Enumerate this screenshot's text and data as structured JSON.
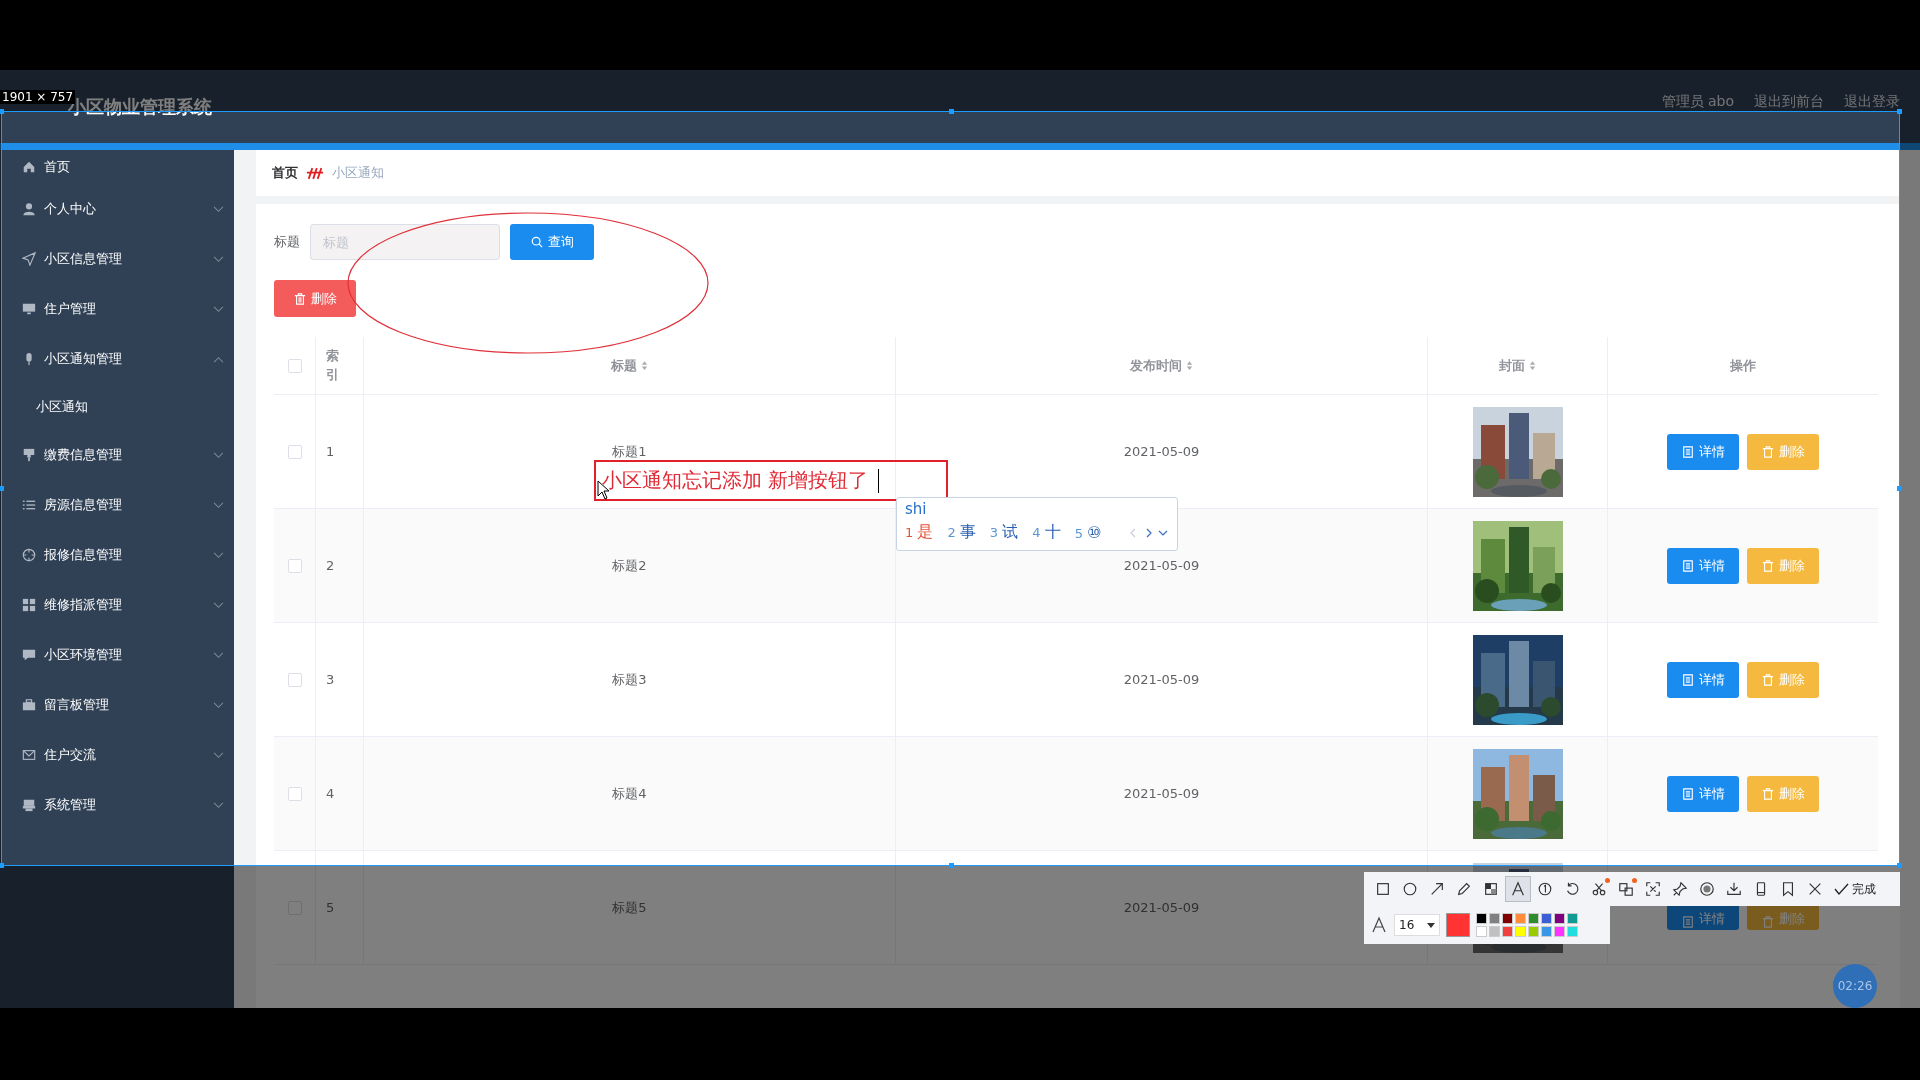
{
  "capture": {
    "size_label": "1901 × 757"
  },
  "header": {
    "title": "小区物业管理系统",
    "links": [
      "管理员 abo",
      "退出到前台",
      "退出登录"
    ]
  },
  "sidebar": {
    "items": [
      {
        "label": "首页",
        "kind": "link"
      },
      {
        "label": "个人中心",
        "kind": "menu",
        "expanded": false
      },
      {
        "label": "小区信息管理",
        "kind": "menu",
        "expanded": false
      },
      {
        "label": "住户管理",
        "kind": "menu",
        "expanded": false
      },
      {
        "label": "小区通知管理",
        "kind": "menu",
        "expanded": true,
        "children": [
          {
            "label": "小区通知"
          }
        ]
      },
      {
        "label": "缴费信息管理",
        "kind": "menu",
        "expanded": false
      },
      {
        "label": "房源信息管理",
        "kind": "menu",
        "expanded": false
      },
      {
        "label": "报修信息管理",
        "kind": "menu",
        "expanded": false
      },
      {
        "label": "维修指派管理",
        "kind": "menu",
        "expanded": false
      },
      {
        "label": "小区环境管理",
        "kind": "menu",
        "expanded": false
      },
      {
        "label": "留言板管理",
        "kind": "menu",
        "expanded": false
      },
      {
        "label": "住户交流",
        "kind": "menu",
        "expanded": false
      },
      {
        "label": "系统管理",
        "kind": "menu",
        "expanded": false
      }
    ]
  },
  "breadcrumb": [
    "首页",
    "小区通知"
  ],
  "search": {
    "label": "标题",
    "placeholder": "标题",
    "button": "查询"
  },
  "delete_button": "删除",
  "table": {
    "all_checked": false,
    "columns": [
      {
        "label": "索引",
        "sortable": false
      },
      {
        "label": "标题",
        "sortable": true
      },
      {
        "label": "发布时间",
        "sortable": true
      },
      {
        "label": "封面",
        "sortable": true
      },
      {
        "label": "操作",
        "sortable": false
      }
    ],
    "rows": [
      {
        "checked": false,
        "index": "1",
        "title": "标题1",
        "published": "2021-05-09",
        "cover": {
          "kind": "picture"
        },
        "actions": [
          "详情",
          "删除"
        ]
      },
      {
        "checked": false,
        "index": "2",
        "title": "标题2",
        "published": "2021-05-09",
        "cover": {
          "kind": "picture"
        },
        "actions": [
          "详情",
          "删除"
        ]
      },
      {
        "checked": false,
        "index": "3",
        "title": "标题3",
        "published": "2021-05-09",
        "cover": {
          "kind": "picture"
        },
        "actions": [
          "详情",
          "删除"
        ]
      },
      {
        "checked": false,
        "index": "4",
        "title": "标题4",
        "published": "2021-05-09",
        "cover": {
          "kind": "picture"
        },
        "actions": [
          "详情",
          "删除"
        ]
      },
      {
        "checked": false,
        "index": "5",
        "title": "标题5",
        "published": "2021-05-09",
        "cover": {
          "kind": "picture"
        },
        "actions": [
          "详情",
          "删除"
        ]
      }
    ]
  },
  "annotation": {
    "text": "小区通知忘记添加 新增按钮了"
  },
  "ime": {
    "input": "shi",
    "candidates": [
      {
        "number": "1",
        "text": "是",
        "selected": true
      },
      {
        "number": "2",
        "text": "事",
        "selected": false
      },
      {
        "number": "3",
        "text": "试",
        "selected": false
      },
      {
        "number": "4",
        "text": "十",
        "selected": false
      },
      {
        "number": "5",
        "text": "⑩",
        "selected": false
      }
    ]
  },
  "toolbar": {
    "tools": [
      {
        "selected": false,
        "dot": false
      },
      {
        "selected": false,
        "dot": false
      },
      {
        "selected": false,
        "dot": false
      },
      {
        "selected": false,
        "dot": false
      },
      {
        "selected": false,
        "dot": false
      },
      {
        "selected": true,
        "dot": false
      },
      {
        "selected": false,
        "dot": false
      },
      {
        "selected": false,
        "dot": false
      },
      {
        "selected": false,
        "dot": true
      },
      {
        "selected": false,
        "dot": true
      },
      {
        "selected": false,
        "dot": false
      },
      {
        "selected": false,
        "dot": false
      },
      {
        "selected": false,
        "dot": false
      },
      {
        "selected": false,
        "dot": false
      },
      {
        "selected": false,
        "dot": false
      },
      {
        "selected": false,
        "dot": false
      },
      {
        "selected": false,
        "dot": false
      }
    ],
    "done": "完成",
    "font_size": "16",
    "current": {
      "color": "#ff3333"
    },
    "swatches": [
      {
        "color": "#000000"
      },
      {
        "color": "#808080"
      },
      {
        "color": "#800000"
      },
      {
        "color": "#ff8c3a"
      },
      {
        "color": "#2e8b2e"
      },
      {
        "color": "#3c5fd6"
      },
      {
        "color": "#800080"
      },
      {
        "color": "#0f9a94"
      },
      {
        "color": "#ffffff"
      },
      {
        "color": "#c0c0c0"
      },
      {
        "color": "#f04040"
      },
      {
        "color": "#ffff00"
      },
      {
        "color": "#99cc00"
      },
      {
        "color": "#3c96e6"
      },
      {
        "color": "#ff33ff"
      },
      {
        "color": "#22dddd"
      }
    ]
  },
  "timer": "02:26"
}
